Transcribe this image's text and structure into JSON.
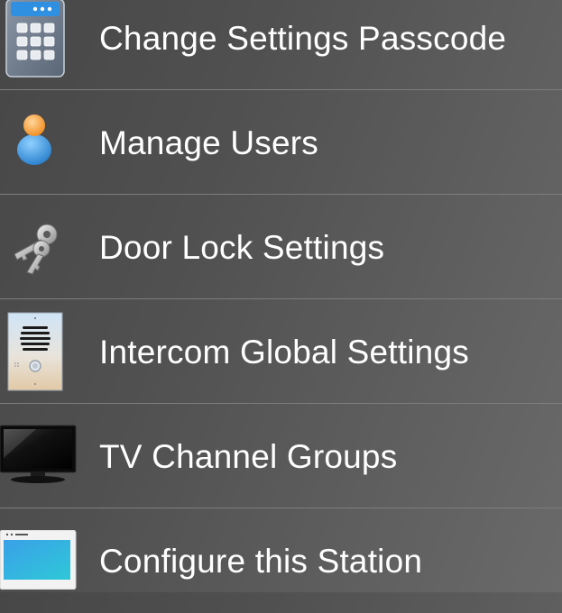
{
  "menu": {
    "items": [
      {
        "label": "Change Settings Passcode",
        "icon": "keypad-icon"
      },
      {
        "label": "Manage Users",
        "icon": "user-icon"
      },
      {
        "label": "Door Lock Settings",
        "icon": "keys-icon"
      },
      {
        "label": "Intercom Global Settings",
        "icon": "intercom-icon"
      },
      {
        "label": "TV Channel Groups",
        "icon": "tv-icon"
      },
      {
        "label": "Configure this Station",
        "icon": "station-screen-icon"
      }
    ]
  }
}
